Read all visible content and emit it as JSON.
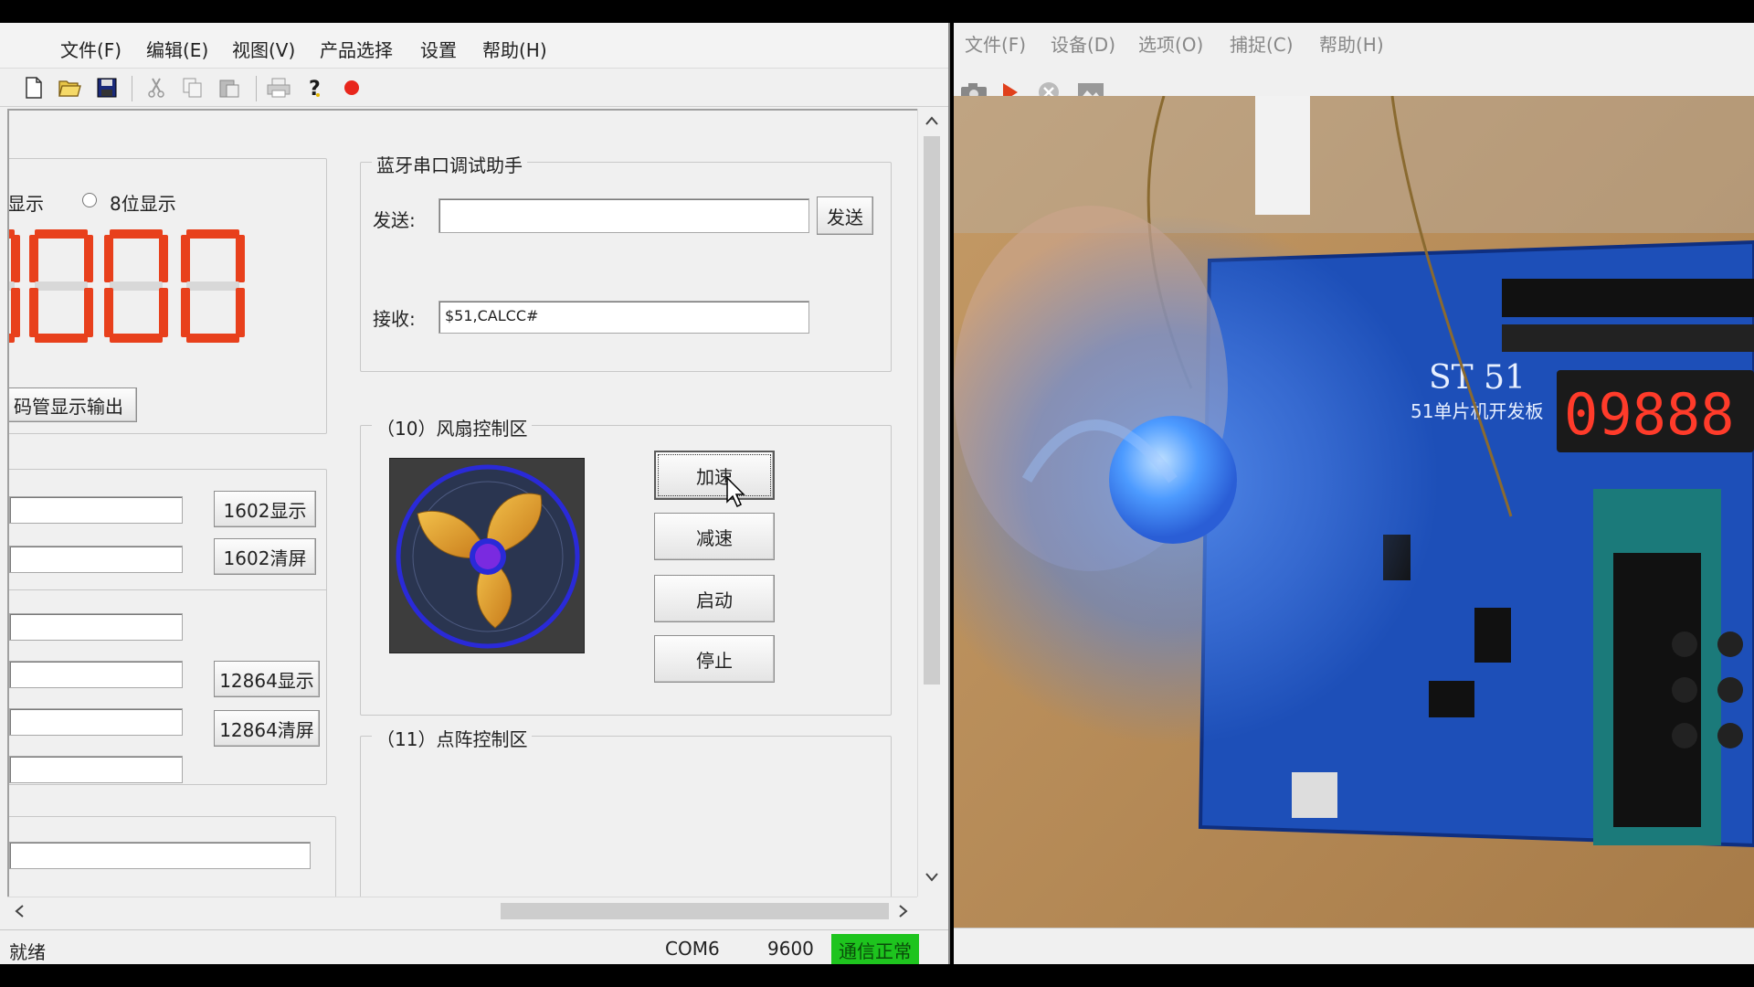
{
  "left_window": {
    "menu": [
      "文件(F)",
      "编辑(E)",
      "视图(V)",
      "产品选择",
      "设置",
      "帮助(H)"
    ],
    "display_section": {
      "radio_partial_label": "显示",
      "radio_8bit_label": "8位显示",
      "output_button": "码管显示输出"
    },
    "lcd_section": {
      "btn_1602_show": "1602显示",
      "btn_1602_clear": "1602清屏",
      "btn_12864_show": "12864显示",
      "btn_12864_clear": "12864清屏"
    },
    "bluetooth": {
      "title": "蓝牙串口调试助手",
      "send_label": "发送:",
      "send_value": "",
      "send_button": "发送",
      "recv_label": "接收:",
      "recv_value": "$51,CALCC#"
    },
    "fan": {
      "title": "（10）风扇控制区",
      "speed_up": "加速",
      "speed_down": "减速",
      "start": "启动",
      "stop": "停止"
    },
    "matrix": {
      "title": "（11）点阵控制区"
    },
    "status": {
      "ready": "就绪",
      "port": "COM6",
      "baud": "9600",
      "comm": "通信正常"
    }
  },
  "right_window": {
    "menu": [
      "文件(F)",
      "设备(D)",
      "选项(O)",
      "捕捉(C)",
      "帮助(H)"
    ],
    "board_label": "ST  51",
    "board_sub": "51单片机开发板",
    "seven_seg": "09888"
  },
  "colors": {
    "segment_on": "#e8401c",
    "status_ok": "#1ec41e",
    "board_blue": "#1d4fb8"
  }
}
